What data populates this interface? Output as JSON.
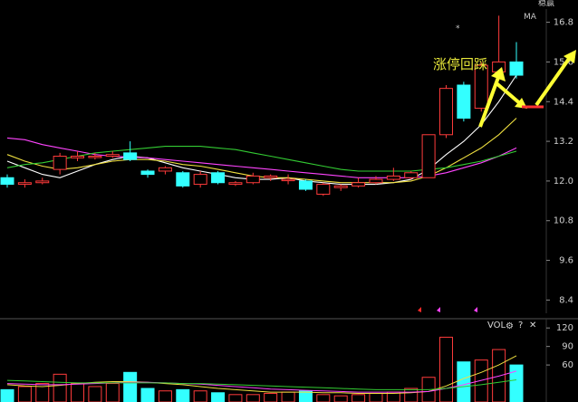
{
  "header": {
    "top_right_label": "稳赢",
    "ma_label": "MA",
    "star": "*"
  },
  "annotation": {
    "text": "涨停回踩"
  },
  "volume_panel": {
    "label": "VOL",
    "settings_icon": "gear-icon",
    "help_label": "?",
    "close_label": "✕",
    "ticks": [
      "120",
      "90",
      "60"
    ]
  },
  "colors": {
    "up": "#ff3b3b",
    "down": "#33ffff",
    "bg": "#000000",
    "ma5": "#ffffff",
    "ma10": "#f0e040",
    "ma20": "#ff44ff",
    "ma60": "#33cc33",
    "arrow": "#ffff33",
    "annotation": "#e8e83a"
  },
  "chart_data": {
    "type": "candlestick",
    "y_ticks": [
      "16.8",
      "15.6",
      "14.4",
      "13.2",
      "12.0",
      "10.8",
      "9.6",
      "8.4"
    ],
    "ylim": [
      8.0,
      17.2
    ],
    "candles": [
      {
        "o": 12.1,
        "c": 11.9,
        "h": 12.2,
        "l": 11.8
      },
      {
        "o": 11.9,
        "c": 11.95,
        "h": 12.05,
        "l": 11.8
      },
      {
        "o": 11.95,
        "c": 12.0,
        "h": 12.1,
        "l": 11.9
      },
      {
        "o": 12.35,
        "c": 12.75,
        "h": 12.85,
        "l": 12.2
      },
      {
        "o": 12.7,
        "c": 12.75,
        "h": 12.9,
        "l": 12.6
      },
      {
        "o": 12.75,
        "c": 12.75,
        "h": 12.85,
        "l": 12.65
      },
      {
        "o": 12.75,
        "c": 12.8,
        "h": 12.9,
        "l": 12.7
      },
      {
        "o": 12.85,
        "c": 12.65,
        "h": 13.2,
        "l": 12.6
      },
      {
        "o": 12.3,
        "c": 12.2,
        "h": 12.35,
        "l": 12.1
      },
      {
        "o": 12.3,
        "c": 12.4,
        "h": 12.45,
        "l": 12.2
      },
      {
        "o": 12.25,
        "c": 11.85,
        "h": 12.3,
        "l": 11.8
      },
      {
        "o": 11.9,
        "c": 12.2,
        "h": 12.3,
        "l": 11.8
      },
      {
        "o": 12.25,
        "c": 11.95,
        "h": 12.3,
        "l": 11.9
      },
      {
        "o": 11.9,
        "c": 11.95,
        "h": 12.0,
        "l": 11.85
      },
      {
        "o": 11.95,
        "c": 12.15,
        "h": 12.25,
        "l": 11.9
      },
      {
        "o": 12.1,
        "c": 12.15,
        "h": 12.2,
        "l": 12.0
      },
      {
        "o": 12.05,
        "c": 12.05,
        "h": 12.2,
        "l": 11.9
      },
      {
        "o": 12.0,
        "c": 11.75,
        "h": 12.05,
        "l": 11.7
      },
      {
        "o": 11.6,
        "c": 11.9,
        "h": 11.95,
        "l": 11.55
      },
      {
        "o": 11.8,
        "c": 11.85,
        "h": 11.9,
        "l": 11.7
      },
      {
        "o": 11.85,
        "c": 11.95,
        "h": 12.1,
        "l": 11.8
      },
      {
        "o": 11.95,
        "c": 12.05,
        "h": 12.15,
        "l": 11.9
      },
      {
        "o": 12.05,
        "c": 12.15,
        "h": 12.4,
        "l": 12.0
      },
      {
        "o": 12.1,
        "c": 12.25,
        "h": 12.3,
        "l": 12.05
      },
      {
        "o": 12.1,
        "c": 13.4,
        "h": 13.4,
        "l": 12.1
      },
      {
        "o": 13.4,
        "c": 14.8,
        "h": 14.9,
        "l": 13.3
      },
      {
        "o": 14.9,
        "c": 13.9,
        "h": 15.0,
        "l": 13.8
      },
      {
        "o": 14.2,
        "c": 15.5,
        "h": 15.6,
        "l": 14.1
      },
      {
        "o": 15.3,
        "c": 15.6,
        "h": 17.0,
        "l": 15.2
      },
      {
        "o": 15.6,
        "c": 15.2,
        "h": 16.2,
        "l": 15.1
      }
    ],
    "ma_lines": [
      {
        "values": [
          12.6,
          12.4,
          12.2,
          12.1,
          12.3,
          12.5,
          12.65,
          12.75,
          12.7,
          12.55,
          12.4,
          12.3,
          12.2,
          12.1,
          12.05,
          12.05,
          12.1,
          12.0,
          11.95,
          11.9,
          11.9,
          11.9,
          11.95,
          12.05,
          12.35,
          12.8,
          13.2,
          13.7,
          14.4,
          15.2
        ]
      },
      {
        "values": [
          12.8,
          12.6,
          12.45,
          12.35,
          12.4,
          12.5,
          12.6,
          12.65,
          12.65,
          12.6,
          12.5,
          12.45,
          12.35,
          12.25,
          12.15,
          12.1,
          12.1,
          12.05,
          12.0,
          11.95,
          11.95,
          11.95,
          11.95,
          12.0,
          12.15,
          12.4,
          12.7,
          13.0,
          13.4,
          13.9
        ]
      },
      {
        "values": [
          13.3,
          13.25,
          13.1,
          13.0,
          12.9,
          12.8,
          12.75,
          12.72,
          12.7,
          12.65,
          12.6,
          12.55,
          12.5,
          12.45,
          12.4,
          12.35,
          12.3,
          12.25,
          12.2,
          12.15,
          12.1,
          12.1,
          12.1,
          12.1,
          12.15,
          12.25,
          12.4,
          12.55,
          12.75,
          13.0
        ]
      },
      {
        "values": [
          12.4,
          12.5,
          12.55,
          12.65,
          12.75,
          12.85,
          12.9,
          12.95,
          13.0,
          13.05,
          13.05,
          13.05,
          13.0,
          12.95,
          12.85,
          12.75,
          12.65,
          12.55,
          12.45,
          12.35,
          12.3,
          12.3,
          12.3,
          12.3,
          12.35,
          12.4,
          12.5,
          12.6,
          12.75,
          12.9
        ]
      }
    ],
    "volume": {
      "ylim": [
        0,
        135
      ],
      "ticks": [
        120,
        90,
        60
      ],
      "values": [
        20,
        25,
        30,
        45,
        30,
        25,
        30,
        48,
        22,
        18,
        20,
        18,
        15,
        12,
        12,
        14,
        16,
        18,
        12,
        10,
        12,
        14,
        16,
        22,
        40,
        105,
        65,
        68,
        85,
        60
      ],
      "ma_lines": [
        {
          "values": [
            28,
            26,
            25,
            27,
            30,
            32,
            33,
            33,
            32,
            30,
            28,
            25,
            22,
            20,
            18,
            16,
            16,
            16,
            15,
            15,
            14,
            14,
            14,
            15,
            17,
            26,
            38,
            48,
            60,
            75
          ]
        },
        {
          "values": [
            30,
            29,
            28,
            28,
            29,
            30,
            31,
            32,
            32,
            31,
            30,
            29,
            27,
            25,
            23,
            21,
            20,
            19,
            18,
            17,
            16,
            16,
            16,
            16,
            17,
            22,
            28,
            35,
            42,
            50
          ]
        },
        {
          "values": [
            35,
            34,
            33,
            32,
            31,
            31,
            31,
            31,
            31,
            31,
            30,
            30,
            29,
            28,
            27,
            26,
            25,
            24,
            23,
            22,
            21,
            20,
            20,
            20,
            20,
            22,
            25,
            28,
            32,
            36
          ]
        }
      ]
    }
  }
}
